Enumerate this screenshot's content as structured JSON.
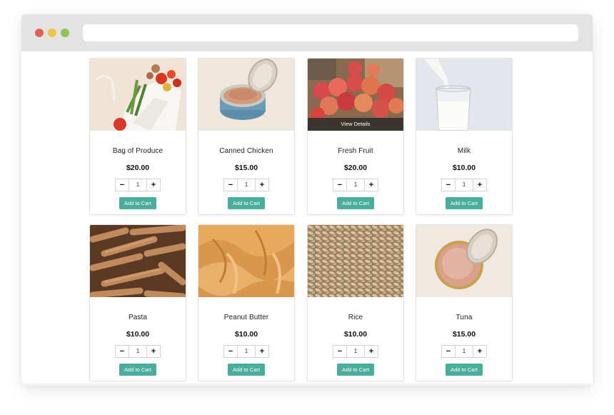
{
  "window": {
    "url": ""
  },
  "products": [
    {
      "name": "Bag of Produce",
      "price": "$20.00",
      "quantity": "1",
      "button": "Add to Cart",
      "image": "produce-bag-image"
    },
    {
      "name": "Canned Chicken",
      "price": "$15.00",
      "quantity": "1",
      "button": "Add to Cart",
      "image": "canned-chicken-image"
    },
    {
      "name": "Fresh Fruit",
      "price": "$20.00",
      "quantity": "1",
      "button": "Add to Cart",
      "image": "fresh-fruit-image",
      "overlay": "View Details"
    },
    {
      "name": "Milk",
      "price": "$10.00",
      "quantity": "1",
      "button": "Add to Cart",
      "image": "milk-image"
    },
    {
      "name": "Pasta",
      "price": "$10.00",
      "quantity": "1",
      "button": "Add to Cart",
      "image": "pasta-image"
    },
    {
      "name": "Peanut Butter",
      "price": "$10.00",
      "quantity": "1",
      "button": "Add to Cart",
      "image": "peanut-butter-image"
    },
    {
      "name": "Rice",
      "price": "$10.00",
      "quantity": "1",
      "button": "Add to Cart",
      "image": "rice-image"
    },
    {
      "name": "Tuna",
      "price": "$15.00",
      "quantity": "1",
      "button": "Add to Cart",
      "image": "tuna-image"
    }
  ],
  "stepper": {
    "minus": "−",
    "plus": "+"
  },
  "colors": {
    "accent": "#4bae9b",
    "titlebar": "#e3e3e3"
  }
}
